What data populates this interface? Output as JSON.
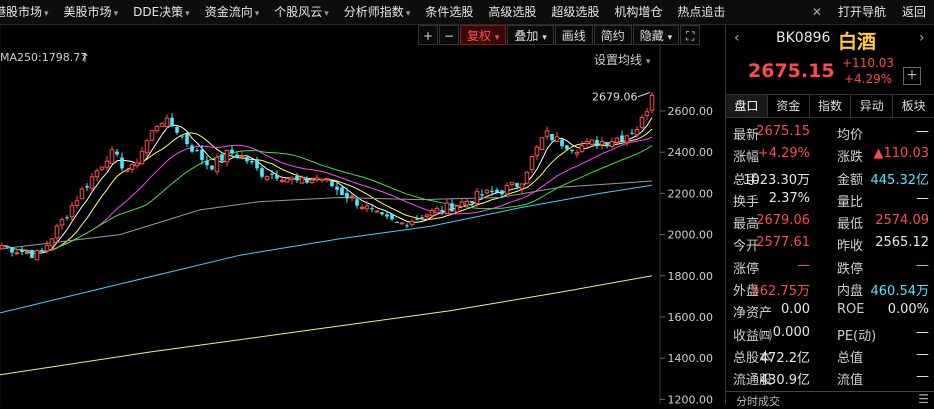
{
  "menu": {
    "items": [
      "港股市场",
      "美股市场",
      "DDE决策",
      "资金流向",
      "个股风云",
      "分析师指数",
      "条件选股",
      "高级选股",
      "超级选股",
      "机构增仓",
      "热点追击"
    ],
    "dropdown_indicator": "▾",
    "close_glyph": "✕",
    "right": [
      "打开导航",
      "返回"
    ]
  },
  "toolbar": {
    "plus": "+",
    "minus": "−",
    "fuquan": "复权",
    "diejia": "叠加",
    "huaxian": "画线",
    "jianyue": "简约",
    "yincang": "隐藏",
    "expand": "⛶"
  },
  "chart": {
    "ma_label": "MA250:1798.77",
    "ma_settings": "设置均线",
    "peak_label": "2679.06",
    "y_ticks": [
      "2600.00",
      "2400.00",
      "2200.00",
      "2000.00",
      "1800.00",
      "1600.00",
      "1400.00",
      "1200.00"
    ]
  },
  "panel": {
    "code": "BK0896",
    "name": "白酒",
    "price": "2675.15",
    "change": "+110.03",
    "change_pct": "+4.29%",
    "add_button": "+",
    "nav_left": "‹",
    "nav_right": "›",
    "tabs": [
      "盘口",
      "资金",
      "指数",
      "异动",
      "板块"
    ],
    "rows": [
      {
        "l1": "最新",
        "v1": "2675.15",
        "c1": "red",
        "l2": "均价",
        "v2": "—",
        "c2": "white"
      },
      {
        "l1": "涨幅",
        "v1": "+4.29%",
        "c1": "red",
        "l2": "涨跌",
        "v2": "▲110.03",
        "c2": "red"
      },
      {
        "l1": "总手",
        "v1": "1023.30万",
        "c1": "white",
        "l2": "金额",
        "v2": "445.32亿",
        "c2": "cyan"
      },
      {
        "l1": "换手",
        "v1": "2.37%",
        "c1": "white",
        "l2": "量比",
        "v2": "—",
        "c2": "white"
      },
      {
        "l1": "最高",
        "v1": "2679.06",
        "c1": "red",
        "l2": "最低",
        "v2": "2574.09",
        "c2": "red"
      },
      {
        "l1": "今开",
        "v1": "2577.61",
        "c1": "red",
        "l2": "昨收",
        "v2": "2565.12",
        "c2": "white"
      },
      {
        "l1": "涨停",
        "v1": "—",
        "c1": "red",
        "l2": "跌停",
        "v2": "—",
        "c2": "cyan"
      },
      {
        "l1": "外盘",
        "v1": "562.75万",
        "c1": "red",
        "l2": "内盘",
        "v2": "460.54万",
        "c2": "cyan"
      },
      {
        "l1": "净资产",
        "v1": "0.00",
        "c1": "white",
        "l2": "ROE",
        "v2": "0.00%",
        "c2": "white"
      },
      {
        "l1": "收益㈣",
        "v1": "0.000",
        "c1": "white",
        "l2": "PE(动)",
        "v2": "—",
        "c2": "white"
      },
      {
        "l1": "总股本",
        "v1": "472.2亿",
        "c1": "white",
        "l2": "总值",
        "v2": "—",
        "c2": "white"
      },
      {
        "l1": "流通股",
        "v1": "430.9亿",
        "c1": "white",
        "l2": "流值",
        "v2": "—",
        "c2": "white"
      }
    ],
    "footer": "分时成交",
    "footer_icon": "☰"
  },
  "colors": {
    "up": "#ff4a4a",
    "down": "#4ee8ff",
    "ma5": "#ffffff",
    "ma10": "#ffff66",
    "ma20": "#ff44ff",
    "ma30": "#44dd44",
    "ma60": "#999999",
    "ma120": "#44ccff",
    "ma250": "#eeee88"
  }
}
